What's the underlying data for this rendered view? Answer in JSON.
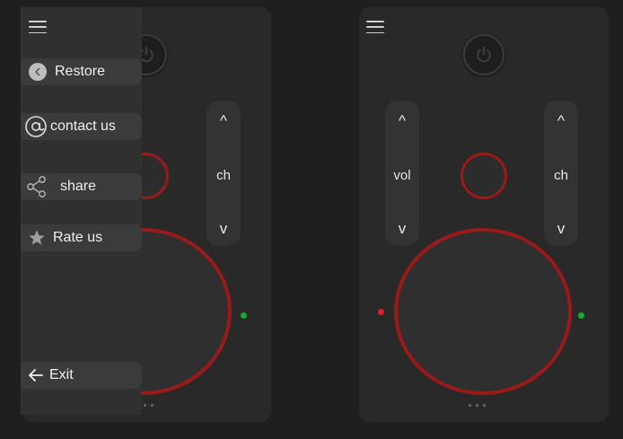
{
  "drawer": {
    "items": [
      {
        "label": "Restore",
        "icon": "back-circle-icon"
      },
      {
        "label": "contact us",
        "icon": "at-sign-icon"
      },
      {
        "label": "share",
        "icon": "share-icon"
      },
      {
        "label": "Rate us",
        "icon": "star-icon"
      },
      {
        "label": "Exit",
        "icon": "arrow-left-icon"
      }
    ]
  },
  "remote_left": {
    "ch_rocker": {
      "up": "^",
      "label": "ch",
      "down": "v"
    }
  },
  "remote_right": {
    "vol_rocker": {
      "up": "^",
      "label": "vol",
      "down": "v"
    },
    "ch_rocker": {
      "up": "^",
      "label": "ch",
      "down": "v"
    }
  },
  "colors": {
    "background": "#1f1f1f",
    "panel": "#292929",
    "accent_ring": "#9a1a1a",
    "led_green": "#23a432",
    "led_red": "#e02020"
  }
}
